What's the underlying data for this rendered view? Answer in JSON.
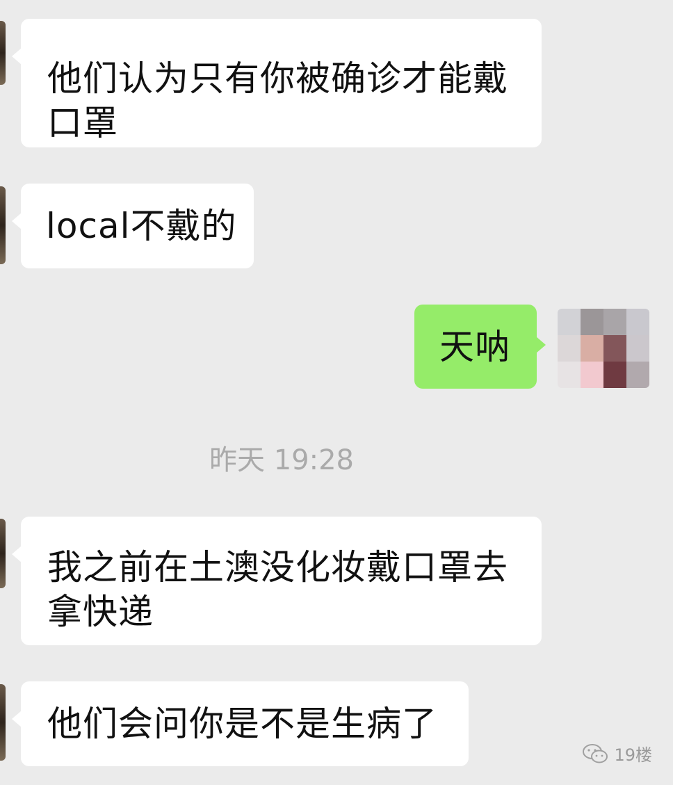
{
  "messages": [
    {
      "side": "received",
      "text": "他们认为只有你被确诊才能戴\n口罩"
    },
    {
      "side": "received",
      "text": "local不戴的"
    },
    {
      "side": "sent",
      "text": "天呐"
    },
    {
      "side": "received",
      "text": "我之前在土澳没化妆戴口罩去\n拿快递"
    },
    {
      "side": "received",
      "text": "他们会问你是不是生病了"
    }
  ],
  "timestamp": "昨天 19:28",
  "watermark": {
    "text": "19楼",
    "icon": "wechat-icon"
  },
  "colors": {
    "background": "#ebebeb",
    "received_bubble": "#ffffff",
    "sent_bubble": "#95ec69",
    "timestamp_text": "#aaaaaa"
  }
}
